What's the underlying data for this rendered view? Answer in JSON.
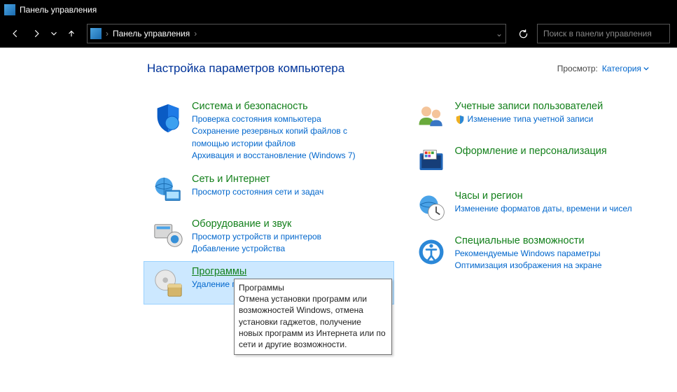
{
  "window": {
    "title": "Панель управления"
  },
  "address": {
    "root": "Панель управления"
  },
  "search": {
    "placeholder": "Поиск в панели управления"
  },
  "header": {
    "title": "Настройка параметров компьютера",
    "view_label": "Просмотр:",
    "view_value": "Категория"
  },
  "categories": {
    "system": {
      "title": "Система и безопасность",
      "links": [
        "Проверка состояния компьютера",
        "Сохранение резервных копий файлов с помощью истории файлов",
        "Архивация и восстановление (Windows 7)"
      ]
    },
    "network": {
      "title": "Сеть и Интернет",
      "links": [
        "Просмотр состояния сети и задач"
      ]
    },
    "hardware": {
      "title": "Оборудование и звук",
      "links": [
        "Просмотр устройств и принтеров",
        "Добавление устройства"
      ]
    },
    "programs": {
      "title": "Программы",
      "links": [
        "Удаление программы"
      ]
    },
    "accounts": {
      "title": "Учетные записи пользователей",
      "links": [
        "Изменение типа учетной записи"
      ]
    },
    "appearance": {
      "title": "Оформление и персонализация",
      "links": []
    },
    "clock": {
      "title": "Часы и регион",
      "links": [
        "Изменение форматов даты, времени и чисел"
      ]
    },
    "ease": {
      "title": "Специальные возможности",
      "links": [
        "Рекомендуемые Windows параметры",
        "Оптимизация изображения на экране"
      ]
    }
  },
  "tooltip": {
    "title": "Программы",
    "body": "Отмена установки программ или возможностей Windows, отмена установки гаджетов, получение новых программ из Интернета или по сети и другие возможности."
  }
}
